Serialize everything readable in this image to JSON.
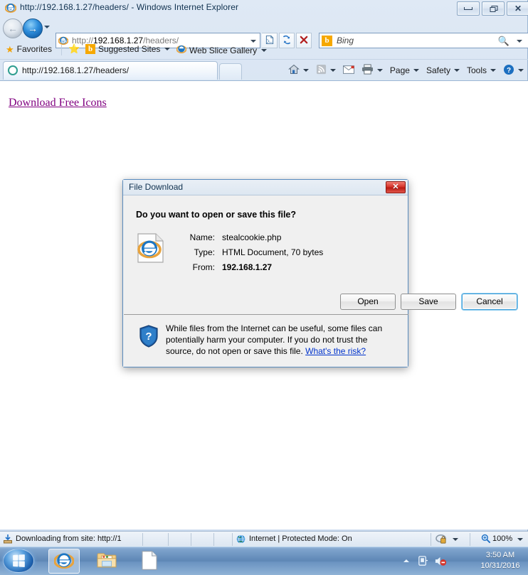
{
  "window": {
    "title": "http://192.168.1.27/headers/ - Windows Internet Explorer",
    "minimize_label": "Minimize",
    "restore_label": "Restore",
    "close_label": "Close"
  },
  "nav": {
    "back_label": "Back",
    "forward_label": "Forward",
    "address_protocol": "http://",
    "address_host": "192.168.1.27",
    "address_path": "/headers/",
    "address_full": "http://192.168.1.27/headers/",
    "compat_label": "Compatibility View",
    "refresh_label": "Refresh",
    "stop_label": "Stop",
    "search_placeholder": "Bing",
    "search_brand": "b",
    "zoom_placeholder": ""
  },
  "favorites_bar": {
    "favorites_label": "Favorites",
    "suggested_sites_label": "Suggested Sites",
    "web_slice_label": "Web Slice Gallery"
  },
  "tabs": [
    {
      "title": "http://192.168.1.27/headers/"
    }
  ],
  "new_tab_label": "",
  "command_bar": {
    "home_label": "Home",
    "feeds_label": "Feeds",
    "mail_label": "Read Mail",
    "print_label": "Print",
    "page_label": "Page",
    "safety_label": "Safety",
    "tools_label": "Tools",
    "help_label": "Help"
  },
  "page": {
    "link_text": "Download Free Icons"
  },
  "dialog": {
    "title": "File Download",
    "close_glyph": "✕",
    "question": "Do you want to open or save this file?",
    "fields": [
      {
        "label": "Name:",
        "value": "stealcookie.php",
        "bold": false
      },
      {
        "label": "Type:",
        "value": "HTML Document, 70 bytes",
        "bold": false
      },
      {
        "label": "From:",
        "value": "192.168.1.27",
        "bold": true
      }
    ],
    "buttons": {
      "open": "Open",
      "save": "Save",
      "cancel": "Cancel"
    },
    "warning_text": "While files from the Internet can be useful, some files can potentially harm your computer. If you do not trust the source, do not open or save this file. ",
    "warning_link": "What's the risk?"
  },
  "status_bar": {
    "download_text": "Downloading from site: http://1",
    "zone_text": "Internet | Protected Mode: On",
    "zoom_text": "100%"
  },
  "taskbar": {
    "start_label": "Start",
    "items": [
      {
        "name": "Internet Explorer",
        "active": true
      },
      {
        "name": "Windows Explorer",
        "active": false
      },
      {
        "name": "Document",
        "active": false
      }
    ],
    "clock_time": "3:50 AM",
    "clock_date": "10/31/2016"
  },
  "colors": {
    "link_visited": "#800080",
    "dialog_bg": "#f0f0f0",
    "focus_blue": "#3c9bd6",
    "close_red": "#d6342b"
  }
}
